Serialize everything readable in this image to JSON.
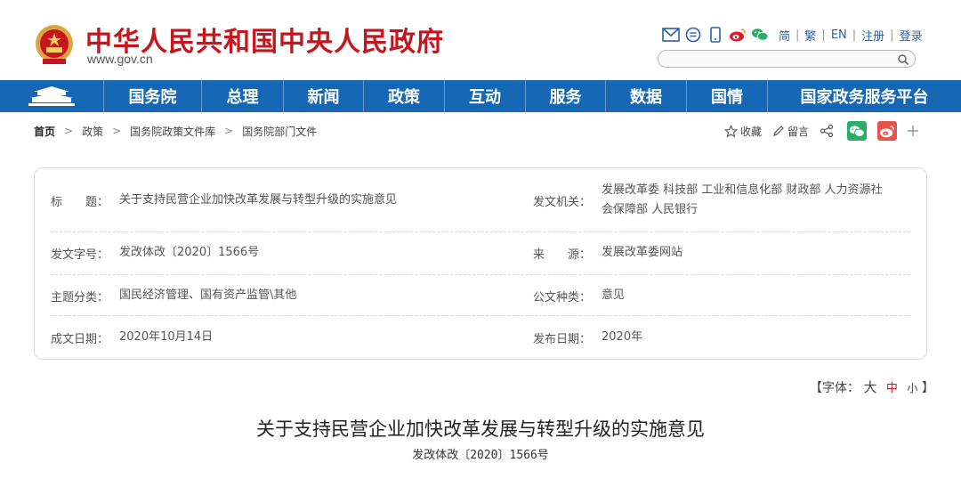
{
  "header": {
    "title": "中华人民共和国中央人民政府",
    "url": "www.gov.cn",
    "tools": {
      "icons": [
        "mail-icon",
        "chat-icon",
        "mobile-icon",
        "weibo-icon",
        "wechat-icon"
      ],
      "links": [
        "简",
        "繁",
        "EN",
        "注册",
        "登录"
      ]
    },
    "search": {
      "placeholder": ""
    }
  },
  "nav": {
    "items": [
      "国务院",
      "总理",
      "新闻",
      "政策",
      "互动",
      "服务",
      "数据",
      "国情",
      "国家政务服务平台"
    ]
  },
  "breadcrumb": [
    "首页",
    "政策",
    "国务院政策文件库",
    "国务院部门文件"
  ],
  "share": {
    "collect": "收藏",
    "message": "留言"
  },
  "meta": {
    "title_label": "标　　题：",
    "title_value": "关于支持民营企业加快改革发展与转型升级的实施意见",
    "issuer_label": "发文机关：",
    "issuer_value_line1": "发展改革委 科技部 工业和信息化部 财政部 人力资源社",
    "issuer_value_line2": "会保障部 人民银行",
    "docno_label": "发文字号：",
    "docno_value": "发改体改〔2020〕1566号",
    "source_label": "来　　源：",
    "source_value": "发展改革委网站",
    "topic_label": "主题分类：",
    "topic_value": "国民经济管理、国有资产监管\\其他",
    "type_label": "公文种类：",
    "type_value": "意见",
    "written_label": "成文日期：",
    "written_value": "2020年10月14日",
    "published_label": "发布日期：",
    "published_value": "2020年"
  },
  "fontsize": {
    "open": "【字体：",
    "large": "大",
    "medium": "中",
    "small": "小",
    "close": "】"
  },
  "article": {
    "title": "关于支持民营企业加快改革发展与转型升级的实施意见",
    "doc_number": "发改体改〔2020〕1566号"
  },
  "colors": {
    "brand_red": "#c4161c",
    "nav_blue": "#1768b4",
    "link_blue": "#2b5fa8"
  }
}
